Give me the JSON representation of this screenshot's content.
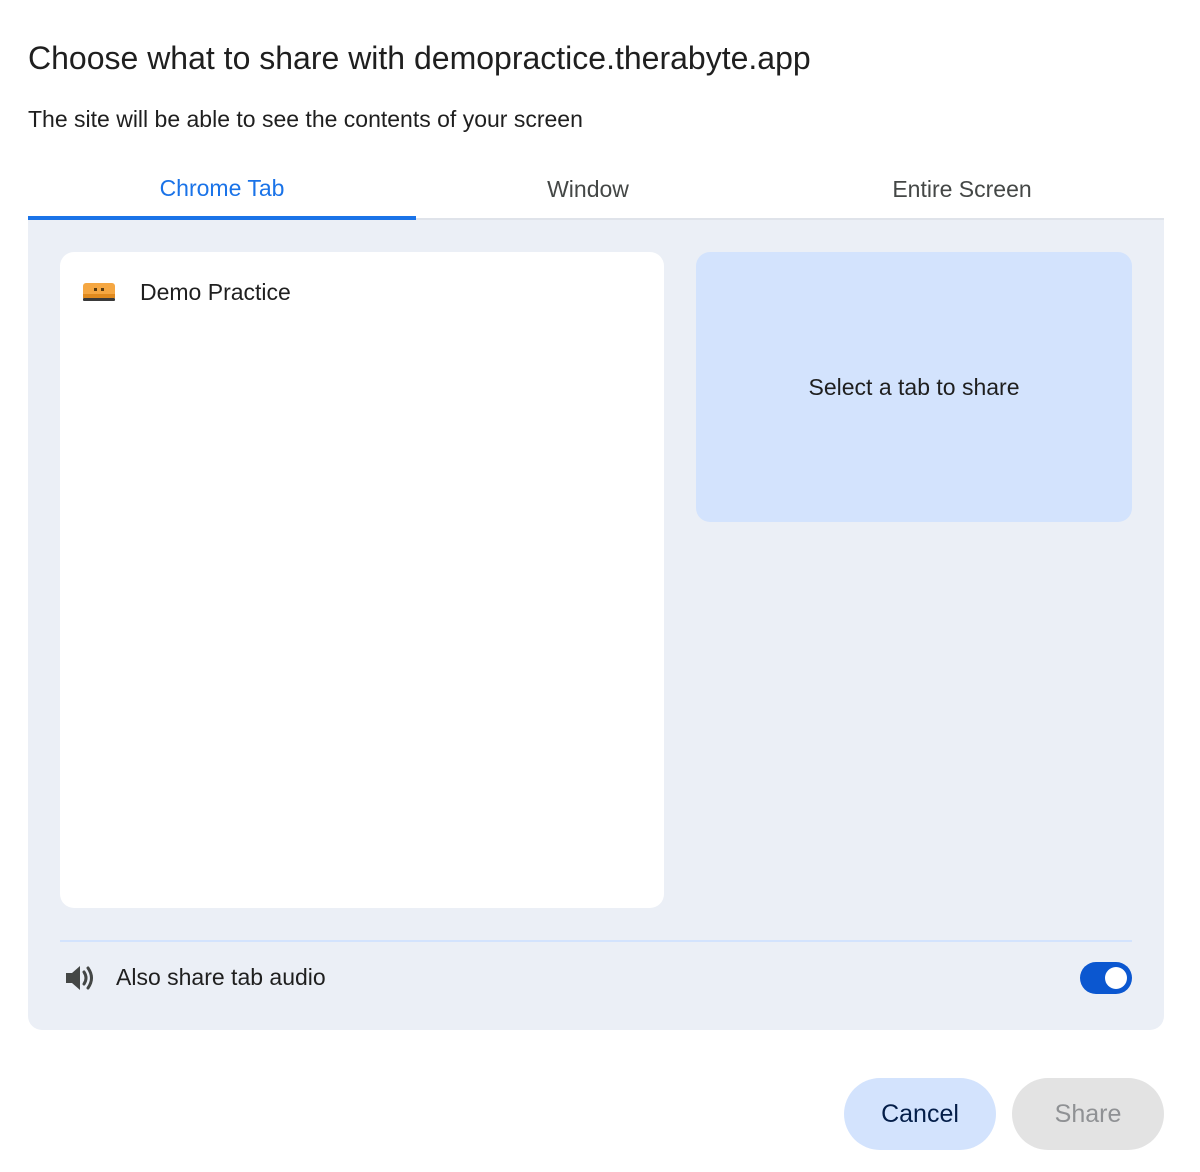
{
  "dialog": {
    "title": "Choose what to share with demopractice.therabyte.app",
    "subtitle": "The site will be able to see the contents of your screen"
  },
  "tabs": [
    {
      "label": "Chrome Tab",
      "active": true
    },
    {
      "label": "Window",
      "active": false
    },
    {
      "label": "Entire Screen",
      "active": false
    }
  ],
  "list": {
    "items": [
      {
        "label": "Demo Practice",
        "icon": "therabyte-favicon-icon"
      }
    ]
  },
  "preview": {
    "text": "Select a tab to share"
  },
  "audio": {
    "label": "Also share tab audio",
    "icon": "speaker-icon",
    "enabled": true
  },
  "buttons": {
    "cancel_label": "Cancel",
    "share_label": "Share",
    "share_enabled": false
  },
  "colors": {
    "accent": "#1a73e8",
    "toggle_on": "#0b57d0",
    "panel_bg": "#ebeff6",
    "preview_bg": "#d3e3fd",
    "cancel_bg": "#d3e3fd",
    "share_disabled_bg": "#e3e3e3"
  }
}
